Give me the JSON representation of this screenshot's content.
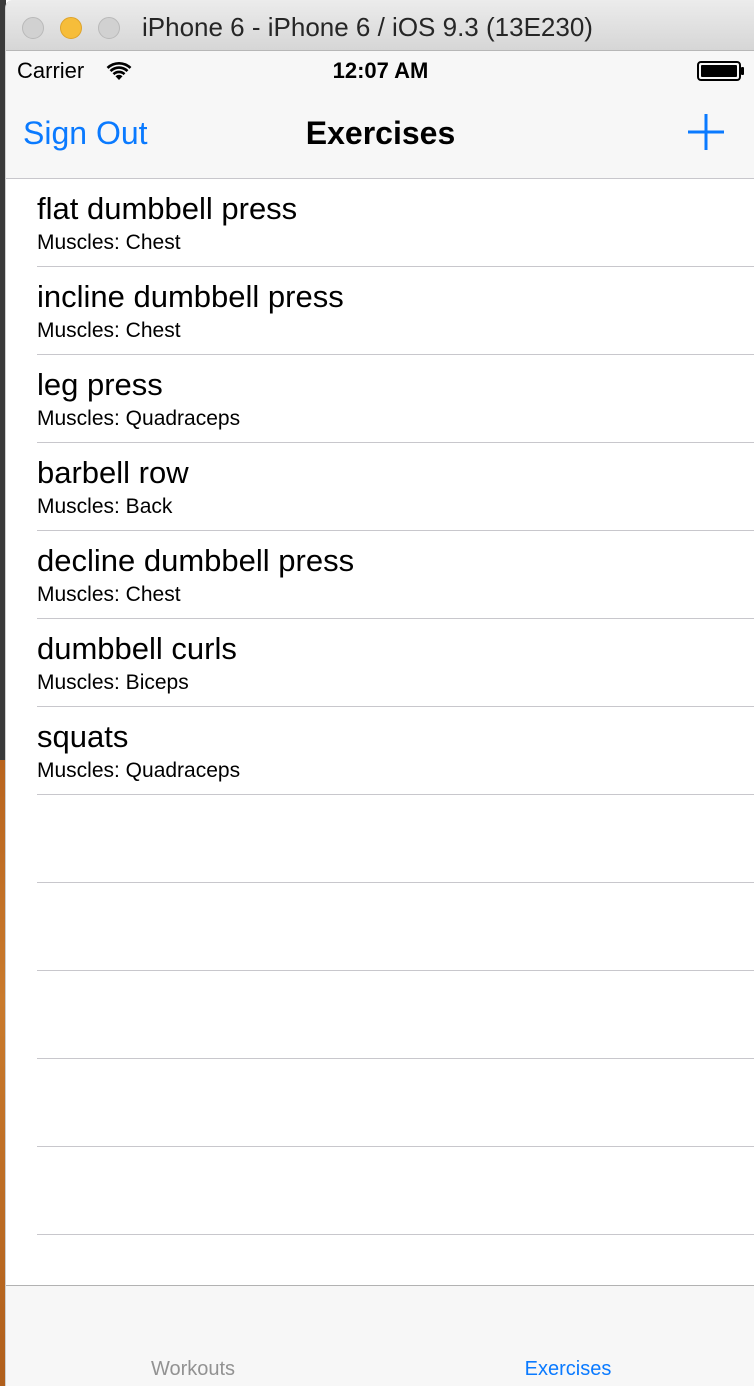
{
  "window": {
    "title": "iPhone 6 - iPhone 6 / iOS 9.3 (13E230)",
    "background_code": "/* configure t"
  },
  "status_bar": {
    "carrier": "Carrier",
    "time": "12:07 AM",
    "icons": [
      "wifi-icon",
      "battery-icon"
    ]
  },
  "nav": {
    "left_button": "Sign Out",
    "title": "Exercises",
    "right_icon": "add-icon"
  },
  "exercises": [
    {
      "name": "flat dumbbell press",
      "muscles": "Muscles: Chest"
    },
    {
      "name": "incline dumbbell press",
      "muscles": "Muscles: Chest"
    },
    {
      "name": "leg press",
      "muscles": "Muscles: Quadraceps"
    },
    {
      "name": "barbell row",
      "muscles": "Muscles: Back"
    },
    {
      "name": "decline dumbbell press",
      "muscles": "Muscles: Chest"
    },
    {
      "name": "dumbbell curls",
      "muscles": "Muscles: Biceps"
    },
    {
      "name": "squats",
      "muscles": "Muscles: Quadraceps"
    }
  ],
  "tab_bar": {
    "tabs": [
      {
        "label": "Workouts",
        "selected": false
      },
      {
        "label": "Exercises",
        "selected": true
      }
    ]
  },
  "colors": {
    "accent": "#0a7aff",
    "inactive_tab": "#929292",
    "separator": "#c8c7cc"
  }
}
